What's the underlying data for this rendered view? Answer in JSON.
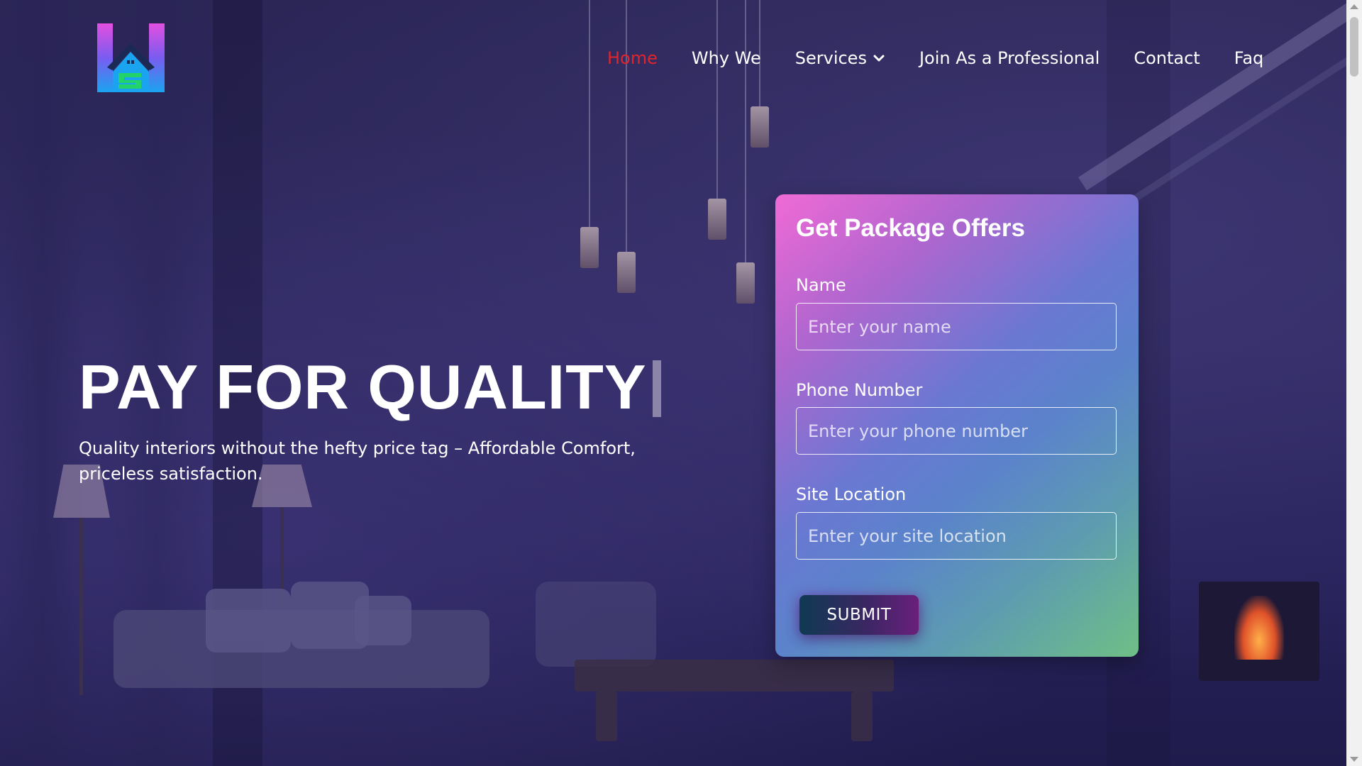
{
  "header": {
    "logo_icon": "house-h-logo-icon",
    "nav": [
      {
        "label": "Home",
        "active": true
      },
      {
        "label": "Why We",
        "active": false
      },
      {
        "label": "Services",
        "active": false,
        "has_dropdown": true
      },
      {
        "label": "Join As a Professional",
        "active": false
      },
      {
        "label": "Contact",
        "active": false
      },
      {
        "label": "Faq",
        "active": false
      }
    ],
    "active_color": "#e2242c"
  },
  "hero": {
    "title": "PAY FOR QUALITY",
    "subtitle": "Quality interiors without the hefty price tag – Affordable Comfort, priceless satisfaction."
  },
  "form": {
    "title": "Get Package Offers",
    "fields": [
      {
        "label": "Name",
        "placeholder": "Enter your name",
        "value": ""
      },
      {
        "label": "Phone Number",
        "placeholder": "Enter your phone number",
        "value": ""
      },
      {
        "label": "Site Location",
        "placeholder": "Enter your site location",
        "value": ""
      }
    ],
    "submit_label": "SUBMIT",
    "gradient_colors": [
      "#f06ad6",
      "#6a78d2",
      "#6fbf86"
    ]
  }
}
